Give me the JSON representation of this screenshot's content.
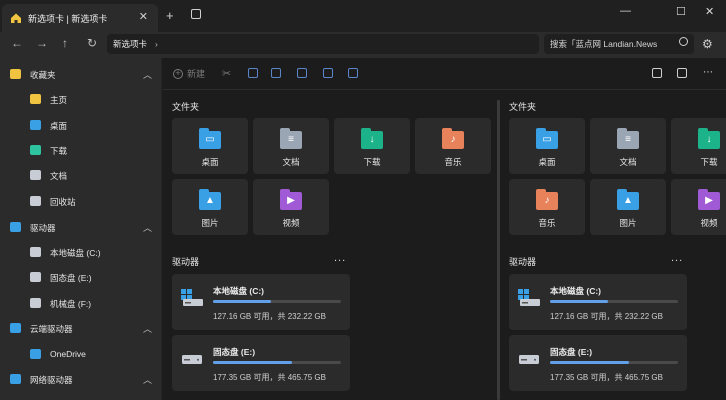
{
  "tab": {
    "title": "新选项卡 | 新选项卡",
    "close": "✕",
    "add": "+"
  },
  "window": {
    "minimize": "—",
    "maximize": "☐",
    "close": "✕"
  },
  "nav": {
    "back": "←",
    "forward": "→",
    "up": "↑",
    "refresh": "↻",
    "settings": "⚙"
  },
  "address": {
    "path": "新选项卡",
    "separator": "›"
  },
  "search": {
    "placeholder": "搜索「蓝点网 Landian.News"
  },
  "sidebar": {
    "items": [
      {
        "label": "收藏夹",
        "icon": "star-icon",
        "color": "#f0c341",
        "section": true
      },
      {
        "label": "主页",
        "icon": "home-icon",
        "color": "#f0c341"
      },
      {
        "label": "桌面",
        "icon": "desktop-icon",
        "color": "#3aa0e6"
      },
      {
        "label": "下载",
        "icon": "download-icon",
        "color": "#2ec4a0"
      },
      {
        "label": "文档",
        "icon": "document-icon",
        "color": "#c8ccd4"
      },
      {
        "label": "回收站",
        "icon": "recycle-bin-icon",
        "color": "#c8ccd4"
      },
      {
        "label": "驱动器",
        "icon": "drives-icon",
        "color": "#3aa0e6",
        "section": true
      },
      {
        "label": "本地磁盘 (C:)",
        "icon": "drive-icon",
        "color": "#c8ccd4"
      },
      {
        "label": "固态盘 (E:)",
        "icon": "drive-icon",
        "color": "#c8ccd4"
      },
      {
        "label": "机械盘 (F:)",
        "icon": "drive-icon",
        "color": "#c8ccd4"
      },
      {
        "label": "云端驱动器",
        "icon": "cloud-icon",
        "color": "#3aa0e6",
        "section": true
      },
      {
        "label": "OneDrive",
        "icon": "onedrive-icon",
        "color": "#3aa0e6"
      },
      {
        "label": "网络驱动器",
        "icon": "network-icon",
        "color": "#3aa0e6",
        "section": true
      }
    ]
  },
  "toolbar": {
    "new_label": "新建"
  },
  "panes": [
    {
      "folders_title": "文件夹",
      "folders": [
        {
          "label": "桌面",
          "icon": "desktop-folder-icon",
          "color": "#3aa0e6",
          "glyph": "▭"
        },
        {
          "label": "文档",
          "icon": "documents-folder-icon",
          "color": "#9aa6b4",
          "glyph": "≡"
        },
        {
          "label": "下载",
          "icon": "downloads-folder-icon",
          "color": "#1db38a",
          "glyph": "↓"
        },
        {
          "label": "音乐",
          "icon": "music-folder-icon",
          "color": "#e8825a",
          "glyph": "♪"
        },
        {
          "label": "图片",
          "icon": "pictures-folder-icon",
          "color": "#3aa0e6",
          "glyph": "▲"
        },
        {
          "label": "视频",
          "icon": "videos-folder-icon",
          "color": "#a05ad6",
          "glyph": "▶"
        }
      ],
      "drives_title": "驱动器",
      "more": "...",
      "drives": [
        {
          "name": "本地磁盘 (C:)",
          "stat": "127.16 GB 可用，共 232.22 GB",
          "used_fraction": 0.453,
          "icon": "windows-drive-icon"
        },
        {
          "name": "固态盘 (E:)",
          "stat": "177.35 GB 可用，共 465.75 GB",
          "used_fraction": 0.619,
          "icon": "drive-icon"
        }
      ]
    },
    {
      "folders_title": "文件夹",
      "folders": [
        {
          "label": "桌面",
          "icon": "desktop-folder-icon",
          "color": "#3aa0e6",
          "glyph": "▭"
        },
        {
          "label": "文档",
          "icon": "documents-folder-icon",
          "color": "#9aa6b4",
          "glyph": "≡"
        },
        {
          "label": "下载",
          "icon": "downloads-folder-icon",
          "color": "#1db38a",
          "glyph": "↓"
        },
        {
          "label": "音乐",
          "icon": "music-folder-icon",
          "color": "#e8825a",
          "glyph": "♪"
        },
        {
          "label": "图片",
          "icon": "pictures-folder-icon",
          "color": "#3aa0e6",
          "glyph": "▲"
        },
        {
          "label": "视频",
          "icon": "videos-folder-icon",
          "color": "#a05ad6",
          "glyph": "▶"
        }
      ],
      "drives_title": "驱动器",
      "more": "...",
      "drives": [
        {
          "name": "本地磁盘 (C:)",
          "stat": "127.16 GB 可用，共 232.22 GB",
          "used_fraction": 0.453,
          "icon": "windows-drive-icon"
        },
        {
          "name": "固态盘 (E:)",
          "stat": "177.35 GB 可用，共 465.75 GB",
          "used_fraction": 0.619,
          "icon": "drive-icon"
        }
      ]
    }
  ]
}
